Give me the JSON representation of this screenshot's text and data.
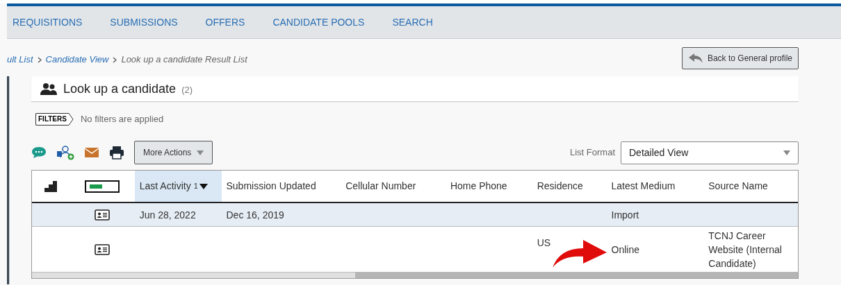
{
  "nav": [
    {
      "label": "REQUISITIONS"
    },
    {
      "label": "SUBMISSIONS"
    },
    {
      "label": "OFFERS"
    },
    {
      "label": "CANDIDATE POOLS"
    },
    {
      "label": "SEARCH"
    }
  ],
  "breadcrumb": [
    {
      "label": "ult List",
      "link": true
    },
    {
      "label": "Candidate View",
      "link": true
    },
    {
      "label": "Look up a candidate Result List",
      "link": false
    }
  ],
  "back_button": "Back to General profile",
  "panel": {
    "title": "Look up a candidate",
    "count": "(2)"
  },
  "filters": {
    "tag": "FILTERS",
    "text": "No filters are applied"
  },
  "more_actions": "More Actions",
  "list_format": {
    "label": "List Format",
    "value": "Detailed View"
  },
  "table": {
    "columns": [
      {
        "kind": "rank",
        "sorted": false
      },
      {
        "kind": "status",
        "sorted": false
      },
      {
        "kind": "text",
        "label": "Last Activity",
        "sort_index": "1",
        "sorted": true
      },
      {
        "kind": "text",
        "label": "Submission Updated",
        "sorted": false
      },
      {
        "kind": "text",
        "label": "Cellular Number",
        "sorted": false
      },
      {
        "kind": "text",
        "label": "Home Phone",
        "sorted": false
      },
      {
        "kind": "text",
        "label": "Residence",
        "sorted": false
      },
      {
        "kind": "text",
        "label": "Latest Medium",
        "sorted": false
      },
      {
        "kind": "text",
        "label": "Source Name",
        "sorted": false
      }
    ],
    "rows": [
      {
        "selected": true,
        "cells": [
          "",
          "",
          "Jun 28, 2022",
          "Dec 16, 2019",
          "",
          "",
          "",
          "Import",
          ""
        ]
      },
      {
        "selected": false,
        "cells": [
          "",
          "",
          "",
          "",
          "",
          "",
          "US",
          "Online",
          "TCNJ Career Website (Internal Candidate)"
        ]
      }
    ]
  }
}
